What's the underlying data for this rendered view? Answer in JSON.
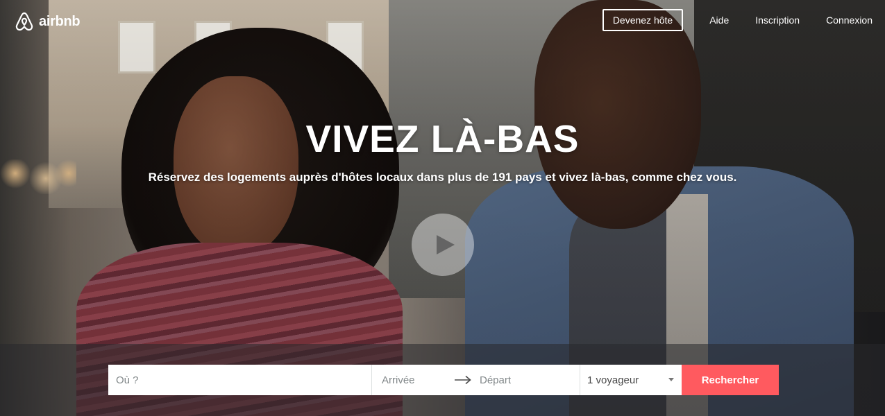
{
  "brand": {
    "name": "airbnb",
    "icon": "airbnb-logo-icon"
  },
  "nav": {
    "host_button": "Devenez hôte",
    "help": "Aide",
    "signup": "Inscription",
    "login": "Connexion"
  },
  "hero": {
    "title": "VIVEZ LÀ-BAS",
    "subtitle": "Réservez des logements auprès d'hôtes locaux dans plus de 191 pays et vivez là-bas, comme chez vous.",
    "play_icon": "play-icon"
  },
  "search": {
    "where_placeholder": "Où ?",
    "checkin_placeholder": "Arrivée",
    "arrow_icon": "arrow-right-icon",
    "checkout_placeholder": "Départ",
    "guests_value": "1 voyageur",
    "submit_label": "Rechercher"
  },
  "colors": {
    "accent": "#ff5a5f",
    "text_on_hero": "#ffffff"
  }
}
